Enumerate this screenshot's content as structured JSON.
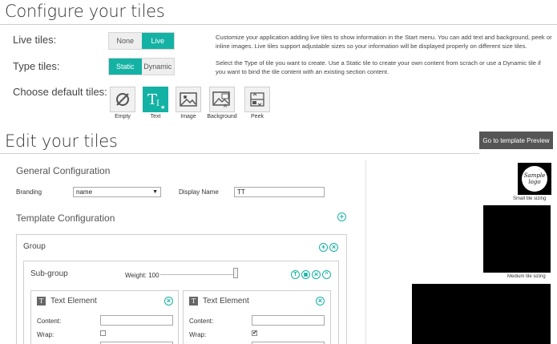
{
  "header": {
    "title": "Configure your tiles",
    "live_tiles_label": "Live tiles:",
    "live_none": "None",
    "live_live": "Live",
    "live_desc": "Customize your application adding live tiles to show information in the Start menu. You can add text and background, peek or inline images. Live tiles support adjustable sizes so your information will be displayed properly on different size tiles.",
    "type_tiles_label": "Type tiles:",
    "type_static": "Static",
    "type_dynamic": "Dynamic",
    "type_desc": "Select the Type of tile you want to create. Use a Static tile to create your own content from scrach or use a Dynamic tile if you want to bind the tile content with an existing section content.",
    "default_tiles_label": "Choose default tiles:",
    "tiles": [
      {
        "label": "Empty",
        "icon": "empty-icon"
      },
      {
        "label": "Text",
        "icon": "text-icon"
      },
      {
        "label": "Image",
        "icon": "image-icon"
      },
      {
        "label": "Background",
        "icon": "background-icon"
      },
      {
        "label": "Peek",
        "icon": "peek-icon"
      }
    ]
  },
  "edit": {
    "title": "Edit your tiles",
    "preview_button": "Go to template Preview",
    "general_config": "General Configuration",
    "branding_label": "Branding",
    "branding_value": "name",
    "display_name_label": "Display Name",
    "display_name_value": "TT",
    "template_config": "Template Configuration",
    "group_label": "Group",
    "subgroup_label": "Sub-group",
    "weight_label": "Weight: 100",
    "text_elements": [
      {
        "title": "Text Element",
        "content_label": "Content:",
        "wrap_label": "Wrap:",
        "wrap_checked": false
      },
      {
        "title": "Text Element",
        "content_label": "Content:",
        "wrap_label": "Wrap:",
        "wrap_checked": true
      }
    ]
  },
  "preview": {
    "sample_logo": "Sample logo",
    "small_label": "Small tile sizing",
    "medium_label": "Medium tile sizing"
  },
  "colors": {
    "accent": "#14b2a4",
    "dark_button": "#555555"
  }
}
